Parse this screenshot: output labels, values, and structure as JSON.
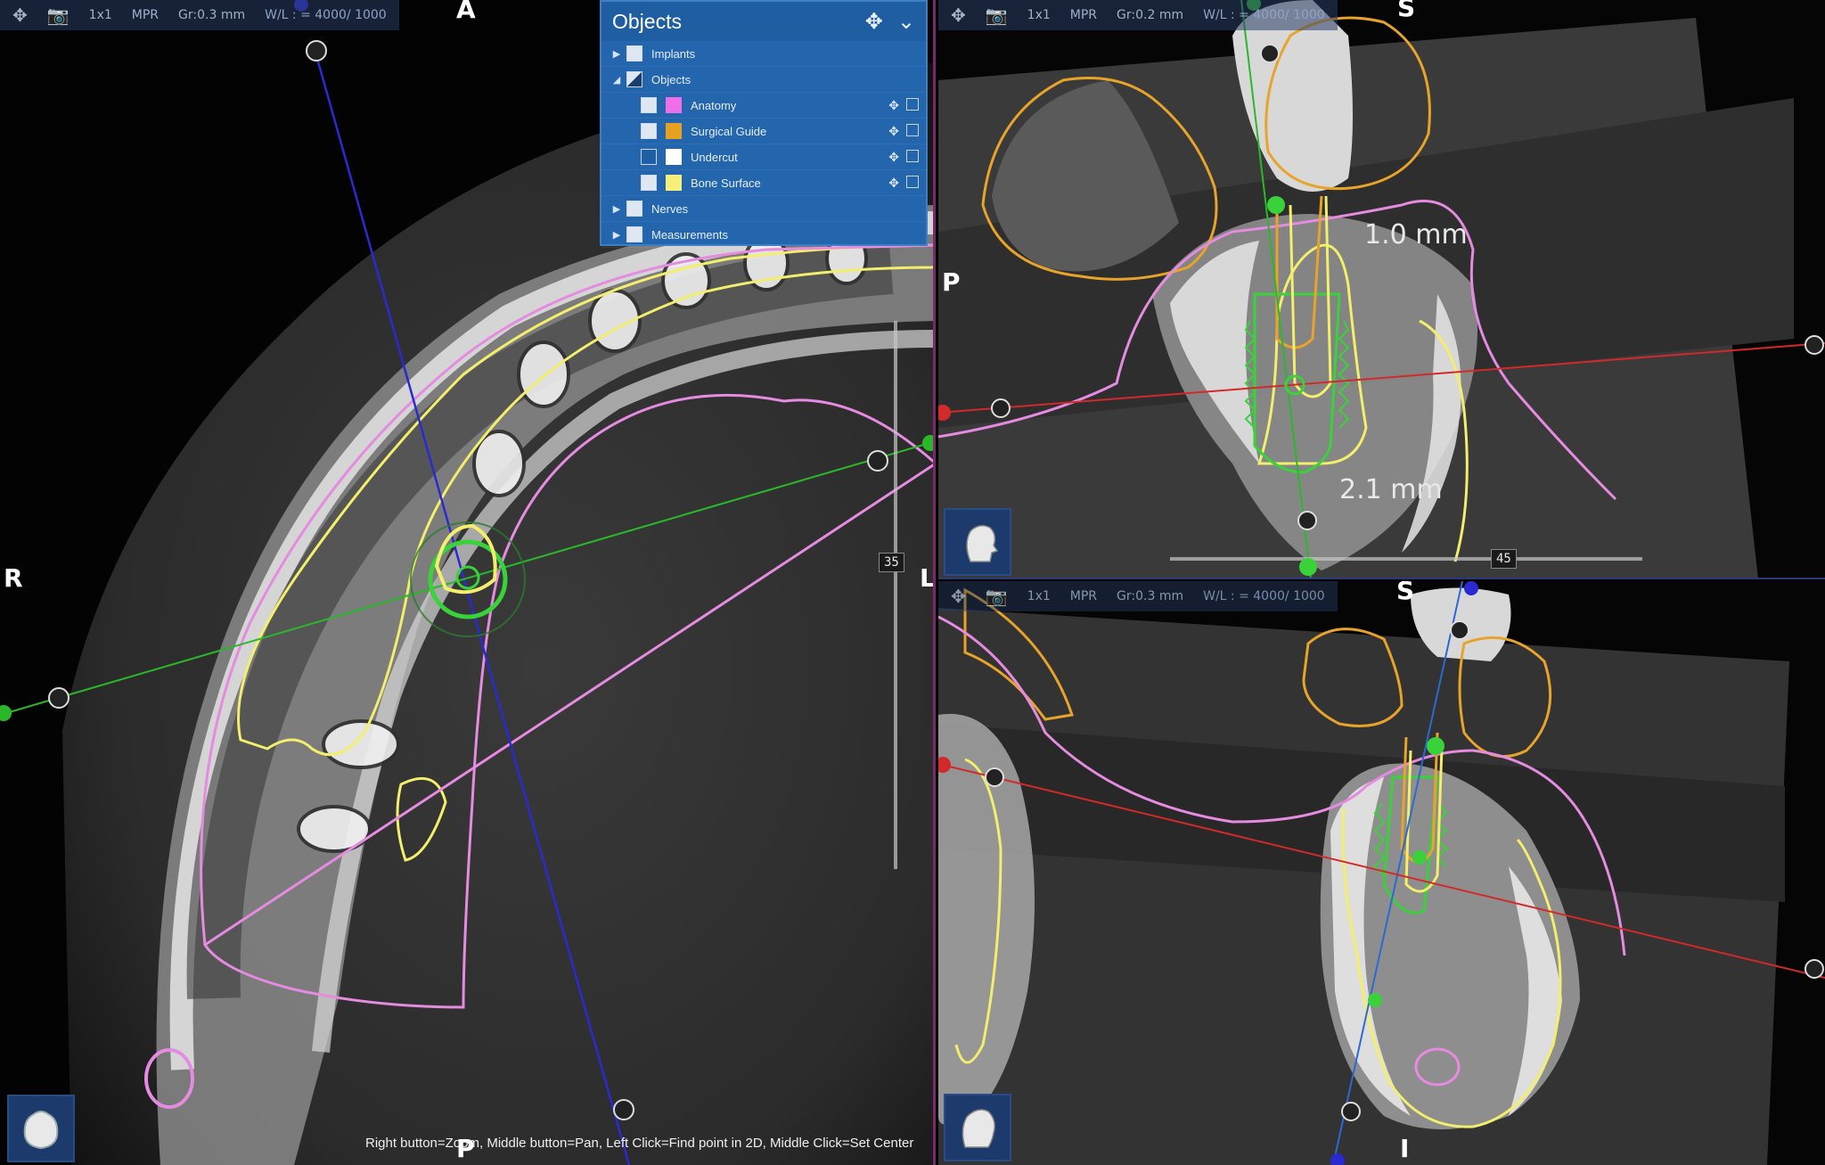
{
  "axial": {
    "toolbar": {
      "move_icon": "move-icon",
      "camera_icon": "camera-icon",
      "layout": "1x1",
      "mode": "MPR",
      "gr": "Gr:0.3 mm",
      "wl": "W/L : = 4000/ 1000"
    },
    "orientation": {
      "top": "A",
      "left": "R",
      "right": "L",
      "bottom": "P"
    },
    "slider_value": "35",
    "status": "Right button=Zoom, Middle button=Pan, Left Click=Find point in 2D, Middle Click=Set Center"
  },
  "sagittal": {
    "toolbar": {
      "layout": "1x1",
      "mode": "MPR",
      "gr": "Gr:0.2 mm",
      "wl": "W/L : = 4000/ 1000"
    },
    "orientation": {
      "top": "S",
      "left": "P"
    },
    "measure_top": "1.0 mm",
    "measure_bottom": "2.1 mm",
    "slider_value": "45"
  },
  "coronal": {
    "toolbar": {
      "layout": "1x1",
      "mode": "MPR",
      "gr": "Gr:0.3 mm",
      "wl": "W/L : = 4000/ 1000"
    },
    "orientation": {
      "top": "S",
      "bottom": "I"
    }
  },
  "objects_panel": {
    "title": "Objects",
    "items": [
      {
        "label": "Implants",
        "level": 0,
        "arrow": "▶"
      },
      {
        "label": "Objects",
        "level": 0,
        "arrow": "◢"
      },
      {
        "label": "Anatomy",
        "level": 1,
        "color": "#f06ee8"
      },
      {
        "label": "Surgical Guide",
        "level": 1,
        "color": "#e8a020"
      },
      {
        "label": "Undercut",
        "level": 1,
        "color": "#ffffff"
      },
      {
        "label": "Bone Surface",
        "level": 1,
        "color": "#f6f07a"
      },
      {
        "label": "Nerves",
        "level": 0,
        "arrow": "▶"
      },
      {
        "label": "Measurements",
        "level": 0,
        "arrow": "▶"
      }
    ]
  },
  "colors": {
    "anatomy": "#e58be0",
    "bone_surface": "#f3ee6c",
    "surgical_guide": "#e8a42a",
    "implant": "#3ad23a",
    "axis_red": "#d22a2a",
    "axis_green": "#2ab82a",
    "axis_blue": "#2a2ad2"
  }
}
